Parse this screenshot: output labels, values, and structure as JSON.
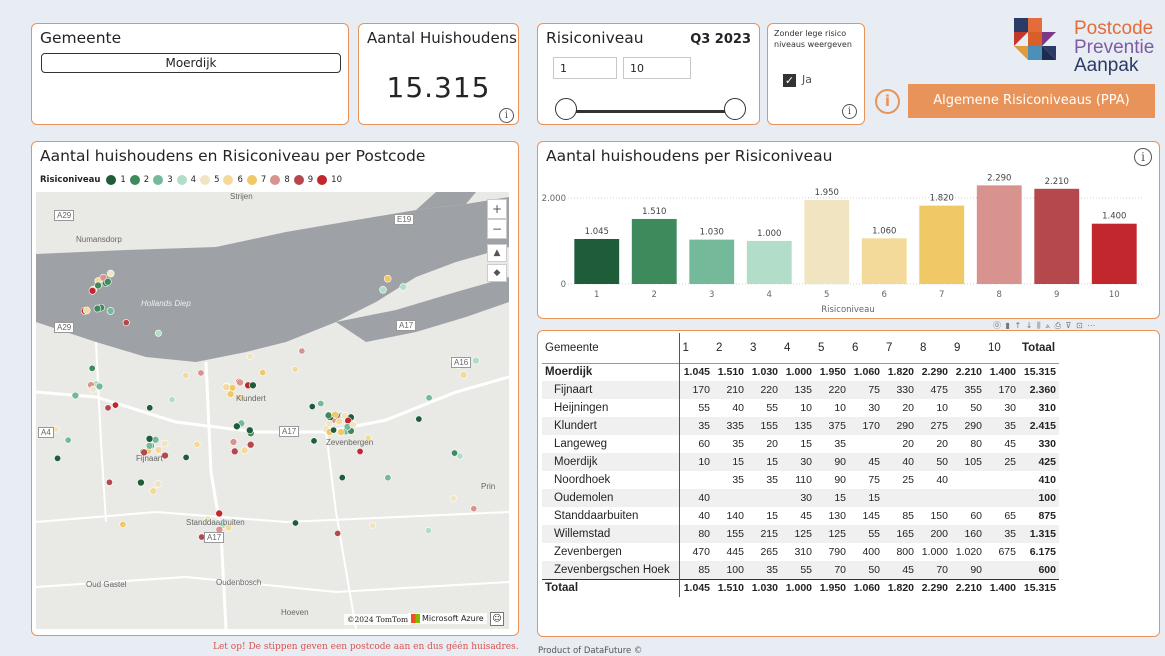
{
  "gemeente_slicer": {
    "title": "Gemeente",
    "selected": "Moerdijk"
  },
  "kpi": {
    "title": "Aantal Huishoudens",
    "value": "15.315"
  },
  "risk_slicer": {
    "title": "Risiconiveau",
    "quarter": "Q3 2023",
    "min": "1",
    "max": "10"
  },
  "empty_toggle": {
    "title": "Zonder lege risico niveaus weergeven",
    "label": "Ja",
    "checked": true
  },
  "logo": {
    "line1": "Postcode",
    "line2": "Preventie",
    "line3": "Aanpak"
  },
  "ppa_button": {
    "label": "Algemene Risiconiveaus (PPA)"
  },
  "map_panel": {
    "title": "Aantal huishoudens en Risiconiveau per Postcode",
    "legend_title": "Risiconiveau",
    "legend": [
      {
        "label": "1",
        "color": "#1e5c3a"
      },
      {
        "label": "2",
        "color": "#3f8a5d"
      },
      {
        "label": "3",
        "color": "#74b99a"
      },
      {
        "label": "4",
        "color": "#b2ddc8"
      },
      {
        "label": "5",
        "color": "#f0e5c0"
      },
      {
        "label": "6",
        "color": "#f3d99a"
      },
      {
        "label": "7",
        "color": "#f0c865"
      },
      {
        "label": "8",
        "color": "#d9938f"
      },
      {
        "label": "9",
        "color": "#b5484c"
      },
      {
        "label": "10",
        "color": "#c1272d"
      }
    ],
    "places": [
      "Strijen",
      "Numansdorp",
      "Hollands Diep",
      "Klundert",
      "Zevenbergen",
      "Fijnaart",
      "Standdaarbuiten",
      "Oud Gastel",
      "Oudenbosch",
      "Hoeven",
      "Prin"
    ],
    "roads": [
      "A29",
      "E19",
      "A17",
      "A16",
      "A4",
      "A29",
      "A17",
      "A17"
    ],
    "attribution": "©2024 TomTom",
    "provider": "Microsoft Azure"
  },
  "bar_panel": {
    "title": "Aantal huishoudens per Risiconiveau",
    "xlabel": "Risiconiveau"
  },
  "chart_data": {
    "type": "bar",
    "categories": [
      "1",
      "2",
      "3",
      "4",
      "5",
      "6",
      "7",
      "8",
      "9",
      "10"
    ],
    "values": [
      1045,
      1510,
      1030,
      1000,
      1950,
      1060,
      1820,
      2290,
      2210,
      1400
    ],
    "labels": [
      "1.045",
      "1.510",
      "1.030",
      "1.000",
      "1.950",
      "1.060",
      "1.820",
      "2.290",
      "2.210",
      "1.400"
    ],
    "colors": [
      "#1e5c3a",
      "#3f8a5d",
      "#74b99a",
      "#b2ddc8",
      "#f0e5c0",
      "#f3d99a",
      "#f0c865",
      "#d9938f",
      "#b5484c",
      "#c1272d"
    ],
    "yticks": [
      {
        "v": 0,
        "t": "0"
      },
      {
        "v": 2000,
        "t": "2.000"
      }
    ],
    "ylim": [
      0,
      2600
    ],
    "title": "Aantal huishoudens per Risiconiveau",
    "xlabel": "Risiconiveau",
    "ylabel": ""
  },
  "table": {
    "headers": [
      "Gemeente",
      "1",
      "2",
      "3",
      "4",
      "5",
      "6",
      "7",
      "8",
      "9",
      "10",
      "Totaal"
    ],
    "rows": [
      [
        "Moerdijk",
        "1.045",
        "1.510",
        "1.030",
        "1.000",
        "1.950",
        "1.060",
        "1.820",
        "2.290",
        "2.210",
        "1.400",
        "15.315"
      ],
      [
        "Fijnaart",
        "170",
        "210",
        "220",
        "135",
        "220",
        "75",
        "330",
        "475",
        "355",
        "170",
        "2.360"
      ],
      [
        "Heijningen",
        "55",
        "40",
        "55",
        "10",
        "10",
        "30",
        "20",
        "10",
        "50",
        "30",
        "310"
      ],
      [
        "Klundert",
        "35",
        "335",
        "155",
        "135",
        "375",
        "170",
        "290",
        "275",
        "290",
        "35",
        "2.415"
      ],
      [
        "Langeweg",
        "60",
        "35",
        "20",
        "15",
        "35",
        "",
        "20",
        "20",
        "80",
        "45",
        "330"
      ],
      [
        "Moerdijk",
        "10",
        "15",
        "15",
        "30",
        "90",
        "45",
        "40",
        "50",
        "105",
        "25",
        "425"
      ],
      [
        "Noordhoek",
        "",
        "35",
        "35",
        "110",
        "90",
        "75",
        "25",
        "40",
        "",
        "",
        "410"
      ],
      [
        "Oudemolen",
        "40",
        "",
        "",
        "30",
        "15",
        "15",
        "",
        "",
        "",
        "",
        "100"
      ],
      [
        "Standdaarbuiten",
        "40",
        "140",
        "15",
        "45",
        "130",
        "145",
        "85",
        "150",
        "60",
        "65",
        "875"
      ],
      [
        "Willemstad",
        "80",
        "155",
        "215",
        "125",
        "125",
        "55",
        "165",
        "200",
        "160",
        "35",
        "1.315"
      ],
      [
        "Zevenbergen",
        "470",
        "445",
        "265",
        "310",
        "790",
        "400",
        "800",
        "1.000",
        "1.020",
        "675",
        "6.175"
      ],
      [
        "Zevenbergschen Hoek",
        "85",
        "100",
        "35",
        "55",
        "70",
        "50",
        "45",
        "70",
        "90",
        "",
        "600"
      ],
      [
        "Totaal",
        "1.045",
        "1.510",
        "1.030",
        "1.000",
        "1.950",
        "1.060",
        "1.820",
        "2.290",
        "2.210",
        "1.400",
        "15.315"
      ]
    ]
  },
  "footer": {
    "warning": "Let op! De stippen geven een postcode aan en dus géén huisadres.",
    "product": "Product of DataFuture ©"
  }
}
